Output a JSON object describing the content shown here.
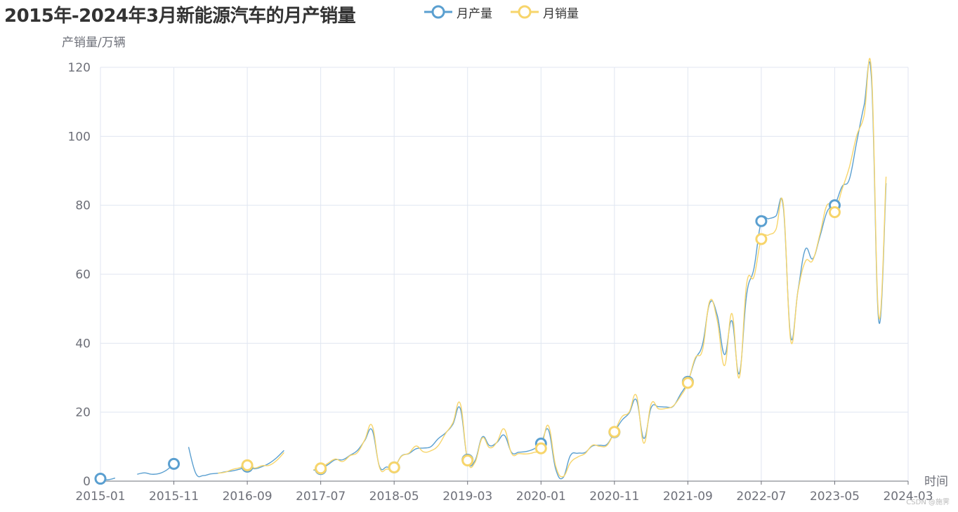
{
  "title": "2015年-2024年3月新能源汽车的月产销量",
  "watermark": "CSDN @施霁",
  "chart_data": {
    "type": "line",
    "ylabel": "产销量/万辆",
    "xlabel": "时间",
    "ylim": [
      0,
      120
    ],
    "y_ticks": [
      0,
      20,
      40,
      60,
      80,
      100,
      120
    ],
    "x_ticks": [
      "2015-01",
      "2015-11",
      "2016-09",
      "2017-07",
      "2018-05",
      "2019-03",
      "2020-01",
      "2020-11",
      "2021-09",
      "2022-07",
      "2023-05",
      "2024-03"
    ],
    "x_start": "2015-01",
    "x_end": "2024-03",
    "grid": true,
    "legend_position": "top",
    "series": [
      {
        "name": "月产量",
        "color": "#5a9fd0",
        "values": [
          0.7,
          0.4,
          0.9,
          null,
          null,
          2,
          2.4,
          2.0,
          2.2,
          3.2,
          5.0,
          null,
          9.9,
          2.2,
          1.6,
          2.1,
          2.3,
          2.7,
          3.0,
          3.5,
          4.2,
          3.6,
          4.2,
          5.2,
          6.8,
          8.9,
          null,
          null,
          null,
          3.2,
          3.5,
          4.8,
          6.2,
          6.2,
          7.5,
          8.9,
          11.8,
          14.8,
          4.3,
          4.1,
          4.0,
          7.3,
          8.0,
          9.4,
          9.6,
          10.0,
          12.3,
          14.0,
          16.5,
          21.1,
          6.2,
          5.9,
          12.8,
          10.3,
          11.2,
          13.3,
          8.3,
          8.4,
          8.6,
          9.3,
          10.9,
          14.9,
          3.5,
          1.0,
          7.4,
          8.1,
          8.3,
          10.2,
          10.4,
          10.7,
          14.2,
          17.6,
          19.7,
          23.5,
          12.4,
          21.3,
          21.6,
          21.5,
          21.7,
          25.2,
          28.8,
          35.3,
          39.7,
          51.7,
          48.1,
          36.7,
          46.5,
          31.2,
          54.0,
          61.7,
          75.4,
          76.1,
          76.9,
          79.4,
          42.0,
          55.3,
          67.2,
          64.5,
          71.0,
          78.3,
          80.0,
          85.4,
          87.6,
          98.4,
          109.0,
          117.1,
          46.4,
          86.4
        ]
      },
      {
        "name": "月销量",
        "color": "#f7d56b",
        "values": [
          null,
          null,
          null,
          null,
          null,
          null,
          null,
          null,
          null,
          null,
          null,
          null,
          null,
          null,
          null,
          null,
          2.3,
          2.6,
          3.4,
          3.9,
          4.6,
          3.8,
          4.5,
          4.6,
          6.0,
          8.3,
          null,
          null,
          null,
          3.3,
          3.7,
          5.2,
          6.4,
          5.7,
          7.4,
          8.3,
          12.0,
          16.1,
          4.0,
          3.5,
          4.0,
          7.2,
          8.1,
          10.2,
          8.5,
          8.8,
          10.3,
          13.8,
          16.9,
          22.5,
          6.0,
          5.4,
          12.5,
          9.7,
          11.3,
          15.1,
          8.0,
          8.0,
          7.9,
          8.3,
          9.5,
          16.1,
          4.4,
          1.3,
          5.3,
          7.0,
          8.0,
          10.4,
          10.1,
          10.4,
          14.3,
          18.6,
          20.0,
          24.8,
          11.0,
          22.4,
          21.0,
          21.1,
          21.8,
          24.6,
          28.5,
          35.7,
          38.1,
          52.3,
          46.6,
          33.5,
          48.6,
          30.0,
          57.1,
          59.3,
          70.2,
          71.4,
          73.0,
          80.2,
          40.9,
          55.1,
          63.7,
          64.0,
          71.7,
          80.2,
          78.0,
          84.6,
          91.1,
          100.2,
          106.0,
          119.1,
          47.7,
          88.3
        ]
      }
    ]
  }
}
